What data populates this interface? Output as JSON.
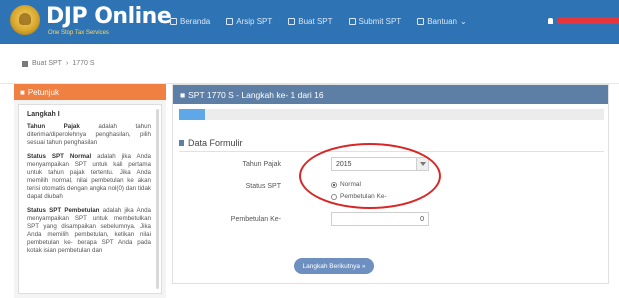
{
  "app": {
    "brand": "DJP Online",
    "tagline": "One Stop Tax Services"
  },
  "nav": {
    "items": [
      {
        "icon": "home-icon",
        "label": "Beranda"
      },
      {
        "icon": "archive-icon",
        "label": "Arsip SPT"
      },
      {
        "icon": "edit-icon",
        "label": "Buat SPT"
      },
      {
        "icon": "send-icon",
        "label": "Submit SPT"
      },
      {
        "icon": "help-icon",
        "label": "Bantuan"
      }
    ],
    "user_color": "#e8353a"
  },
  "breadcrumb": {
    "items": [
      "Buat SPT",
      "1770 S"
    ]
  },
  "left_panel": {
    "title": "Petunjuk",
    "heading": "Langkah I",
    "paragraphs": [
      {
        "bold": "Tahun Pajak",
        "text": " adalah tahun diterima/diperolehnya penghasilan, pilih sesuai tahun penghasilan"
      },
      {
        "bold": "Status SPT Normal",
        "text": " adalah jika Anda menyampaikan SPT untuk kali pertama untuk tahun pajak tertentu. Jika Anda memilih normal, nilai pembetulan ke akan terisi otomatis dengan angka nol(0) dan tidak dapat diubah"
      },
      {
        "bold": "Status SPT Pembetulan",
        "text": " adalah jika Anda menyampaikan SPT untuk membetulkan SPT yang disampaikan sebelumnya. Jika Anda memilih pembetulan, ketikan nilai pembetulan ke- berapa SPT Anda pada kotak isian pembetulan dan"
      }
    ]
  },
  "main_panel": {
    "title": "SPT 1770 S - Langkah ke- 1 dari 16",
    "progress": 0.06,
    "section_title": "Data Formulir",
    "tahun_pajak_label": "Tahun Pajak",
    "tahun_pajak_value": "2015",
    "status_label": "Status SPT",
    "status_options": [
      "Normal",
      "Pembetulan Ke-"
    ],
    "status_selected": "Normal",
    "pembetulan_label": "Pembetulan Ke-",
    "pembetulan_value": "0",
    "next_label": "Langkah Berikutnya"
  },
  "colors": {
    "navbar": "#2e74b5",
    "panel_header": "#5d7fa6",
    "left_header": "#f07f42",
    "highlight_circle": "#d62828"
  }
}
